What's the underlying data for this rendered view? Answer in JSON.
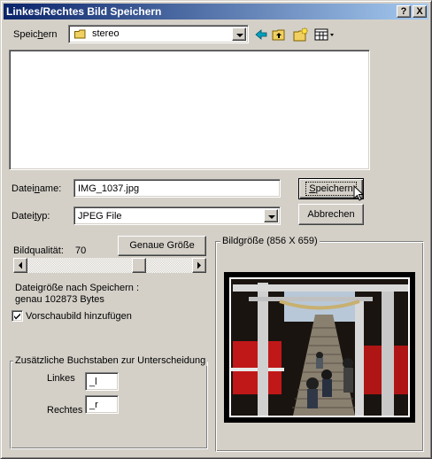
{
  "window": {
    "title": "Linkes/Rechtes Bild Speichern",
    "help_label": "?",
    "close_label": "X"
  },
  "save_in": {
    "label_pre": "Speic",
    "label_ul": "h",
    "label_post": "ern",
    "folder": "stereo"
  },
  "file": {
    "name_label_pre": "Datei",
    "name_label_ul": "n",
    "name_label_post": "ame:",
    "name_value": "IMG_1037.jpg",
    "type_label_pre": "Datei",
    "type_label_ul": "t",
    "type_label_post": "yp:",
    "type_value": "JPEG File"
  },
  "buttons": {
    "save_pre": "",
    "save_ul": "S",
    "save_post": "peichern",
    "cancel": "Abbrechen",
    "exact_size": "Genaue Größe"
  },
  "quality": {
    "label": "Bildqualität:",
    "value": "70",
    "slider_fraction": 0.7
  },
  "filesize": {
    "line1": "Dateigröße nach Speichern :",
    "line2": "genau 102873 Bytes"
  },
  "preview_checkbox": {
    "label": "Vorschaubild hinzufügen",
    "checked": true
  },
  "suffix_group": {
    "title": "Zusätzliche Buchstaben zur Unterscheidung",
    "left_label": "Linkes",
    "left_value": "_l",
    "right_label": "Rechtes",
    "right_value": "_r"
  },
  "image_size": {
    "title": "Bildgröße (856 X 659)"
  },
  "colors": {
    "face": "#d4d0c8",
    "title_start": "#0a246a",
    "title_end": "#a6caf0",
    "folder_yellow": "#f0d060"
  }
}
